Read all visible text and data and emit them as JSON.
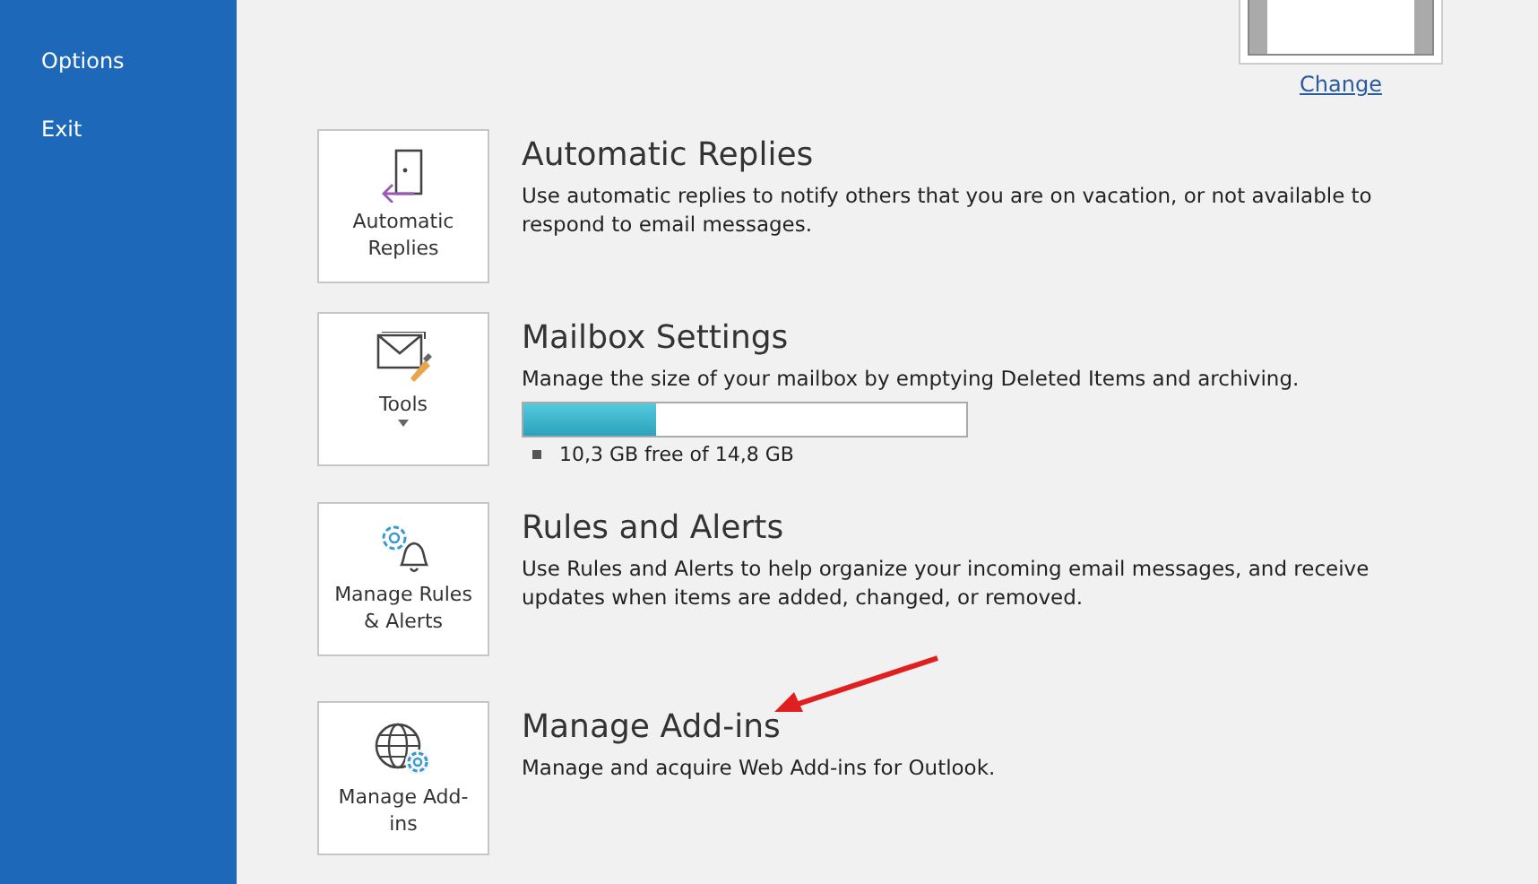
{
  "sidebar": {
    "items": [
      {
        "label": "Options"
      },
      {
        "label": "Exit"
      }
    ]
  },
  "profile": {
    "change_link": "Change"
  },
  "sections": [
    {
      "kind": "replies",
      "button_label": "Automatic Replies",
      "title": "Automatic Replies",
      "description": "Use automatic replies to notify others that you are on vacation, or not available to respond to email messages."
    },
    {
      "kind": "tools",
      "button_label": "Tools",
      "dropdown": true,
      "title": "Mailbox Settings",
      "description": "Manage the size of your mailbox by emptying Deleted Items and archiving.",
      "storage": {
        "level": 0.3,
        "reading": "10,3 GB free of 14,8 GB"
      }
    },
    {
      "kind": "rules",
      "button_label": "Manage Rules & Alerts",
      "title": "Rules and Alerts",
      "description": "Use Rules and Alerts to help organize your incoming email messages, and receive updates when items are added, changed, or removed."
    },
    {
      "kind": "addins",
      "button_label": "Manage Add-ins",
      "title": "Manage Add-ins",
      "description": "Manage and acquire Web Add-ins for Outlook."
    }
  ]
}
